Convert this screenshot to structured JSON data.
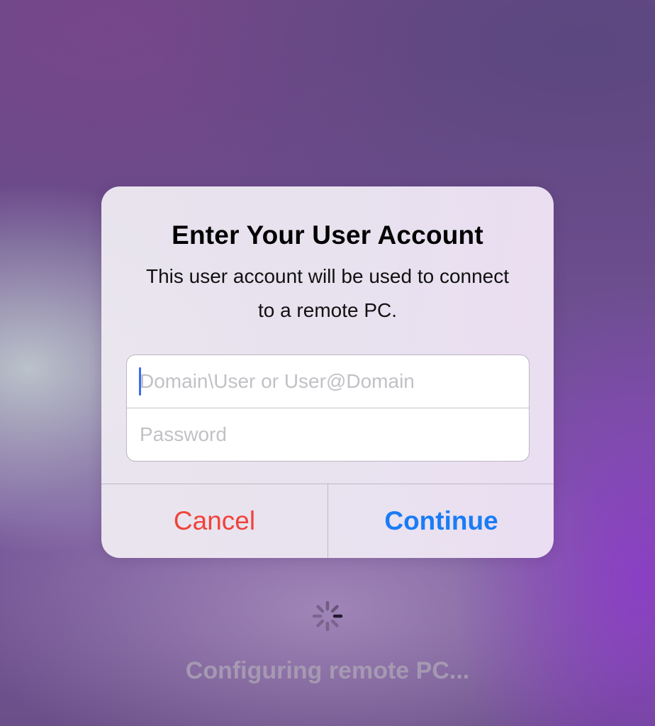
{
  "alert": {
    "title": "Enter Your User Account",
    "message": "This user account will be used to connect to a remote PC.",
    "username_field": {
      "placeholder": "Domain\\User or User@Domain",
      "value": ""
    },
    "password_field": {
      "placeholder": "Password",
      "value": ""
    },
    "cancel_label": "Cancel",
    "continue_label": "Continue"
  },
  "status": {
    "icon": "activity-spinner-icon",
    "text": "Configuring remote PC..."
  },
  "colors": {
    "cancel": "#f0433a",
    "continue": "#1a7cf5",
    "caret": "#3b6cf0"
  }
}
